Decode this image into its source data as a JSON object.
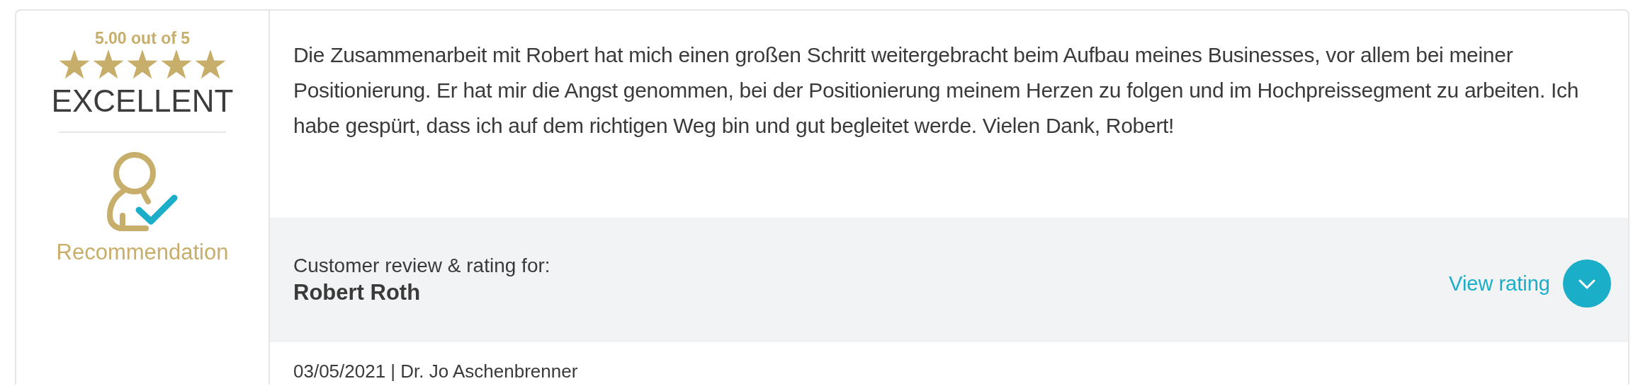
{
  "rating": {
    "score": "5.00 out of 5",
    "stars": 5,
    "verdict": "EXCELLENT",
    "badge": "Recommendation"
  },
  "review": {
    "text": "Die Zusammenarbeit mit Robert hat mich einen großen Schritt weitergebracht beim Aufbau meines Businesses, vor allem bei meiner Positionierung. Er hat mir die Angst genommen, bei der Positionierung meinem Herzen zu folgen und im Hochpreissegment zu arbeiten. Ich habe gespürt, dass ich auf dem richtigen Weg bin und gut begleitet werde. Vielen Dank, Robert!"
  },
  "subject": {
    "label": "Customer review & rating for:",
    "name": "Robert Roth",
    "action": "View rating",
    "expanded": false
  },
  "meta": "03/05/2021 | Dr. Jo Aschenbrenner"
}
